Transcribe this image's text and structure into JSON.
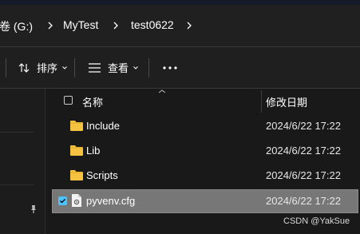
{
  "address_bar": {
    "crumbs": [
      "卷 (G:)",
      "MyTest",
      "test0622"
    ]
  },
  "toolbar": {
    "sort_label": "排序",
    "view_label": "查看",
    "more_label": "···"
  },
  "file_list": {
    "columns": {
      "name": "名称",
      "date_modified": "修改日期"
    },
    "rows": [
      {
        "name": "Include",
        "date": "2024/6/22 17:22",
        "type": "folder",
        "selected": false
      },
      {
        "name": "Lib",
        "date": "2024/6/22 17:22",
        "type": "folder",
        "selected": false
      },
      {
        "name": "Scripts",
        "date": "2024/6/22 17:22",
        "type": "folder",
        "selected": false
      },
      {
        "name": "pyvenv.cfg",
        "date": "2024/6/22 17:22",
        "type": "config-file",
        "selected": true
      }
    ]
  },
  "watermark": "CSDN @YakSue",
  "colors": {
    "background": "#1c1c1c",
    "selection": "#777777",
    "checkbox_accent": "#4cc2ff",
    "folder": "#f5c242"
  }
}
